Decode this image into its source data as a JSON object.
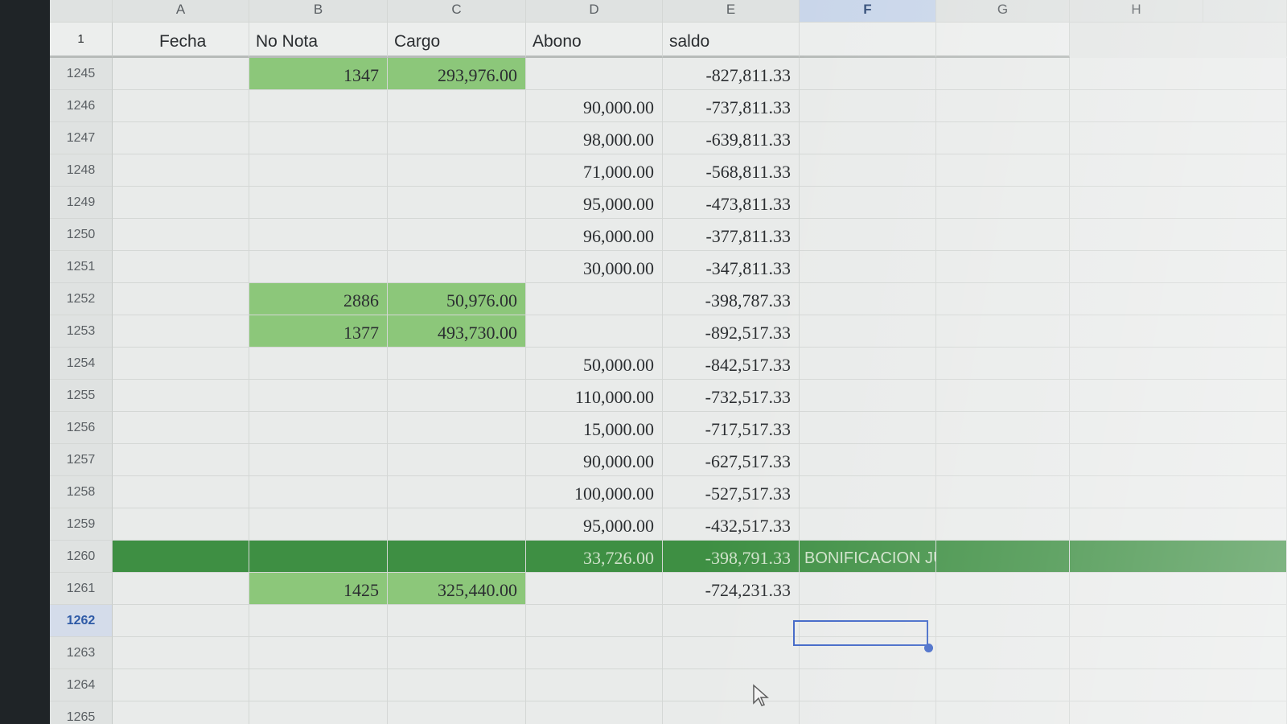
{
  "columns": [
    "A",
    "B",
    "C",
    "D",
    "E",
    "F",
    "G",
    "H"
  ],
  "selected_column": "F",
  "header_row": {
    "row_number": "1",
    "fecha": "Fecha",
    "no_nota": "No Nota",
    "cargo": "Cargo",
    "abono": "Abono",
    "saldo": "saldo"
  },
  "rows": [
    {
      "n": "1245",
      "nota": "1347",
      "cargo": "293,976.00",
      "abono": "",
      "saldo": "-827,811.33",
      "note": ""
    },
    {
      "n": "1246",
      "nota": "",
      "cargo": "",
      "abono": "90,000.00",
      "saldo": "-737,811.33",
      "note": ""
    },
    {
      "n": "1247",
      "nota": "",
      "cargo": "",
      "abono": "98,000.00",
      "saldo": "-639,811.33",
      "note": ""
    },
    {
      "n": "1248",
      "nota": "",
      "cargo": "",
      "abono": "71,000.00",
      "saldo": "-568,811.33",
      "note": ""
    },
    {
      "n": "1249",
      "nota": "",
      "cargo": "",
      "abono": "95,000.00",
      "saldo": "-473,811.33",
      "note": ""
    },
    {
      "n": "1250",
      "nota": "",
      "cargo": "",
      "abono": "96,000.00",
      "saldo": "-377,811.33",
      "note": ""
    },
    {
      "n": "1251",
      "nota": "",
      "cargo": "",
      "abono": "30,000.00",
      "saldo": "-347,811.33",
      "note": ""
    },
    {
      "n": "1252",
      "nota": "2886",
      "cargo": "50,976.00",
      "abono": "",
      "saldo": "-398,787.33",
      "note": ""
    },
    {
      "n": "1253",
      "nota": "1377",
      "cargo": "493,730.00",
      "abono": "",
      "saldo": "-892,517.33",
      "note": ""
    },
    {
      "n": "1254",
      "nota": "",
      "cargo": "",
      "abono": "50,000.00",
      "saldo": "-842,517.33",
      "note": ""
    },
    {
      "n": "1255",
      "nota": "",
      "cargo": "",
      "abono": "110,000.00",
      "saldo": "-732,517.33",
      "note": ""
    },
    {
      "n": "1256",
      "nota": "",
      "cargo": "",
      "abono": "15,000.00",
      "saldo": "-717,517.33",
      "note": ""
    },
    {
      "n": "1257",
      "nota": "",
      "cargo": "",
      "abono": "90,000.00",
      "saldo": "-627,517.33",
      "note": ""
    },
    {
      "n": "1258",
      "nota": "",
      "cargo": "",
      "abono": "100,000.00",
      "saldo": "-527,517.33",
      "note": ""
    },
    {
      "n": "1259",
      "nota": "",
      "cargo": "",
      "abono": "95,000.00",
      "saldo": "-432,517.33",
      "note": ""
    },
    {
      "n": "1260",
      "nota": "",
      "cargo": "",
      "abono": "33,726.00",
      "saldo": "-398,791.33",
      "note": "BONIFICACION JUNIO"
    },
    {
      "n": "1261",
      "nota": "1425",
      "cargo": "325,440.00",
      "abono": "",
      "saldo": "-724,231.33",
      "note": ""
    },
    {
      "n": "1262",
      "nota": "",
      "cargo": "",
      "abono": "",
      "saldo": "",
      "note": ""
    },
    {
      "n": "1263",
      "nota": "",
      "cargo": "",
      "abono": "",
      "saldo": "",
      "note": ""
    },
    {
      "n": "1264",
      "nota": "",
      "cargo": "",
      "abono": "",
      "saldo": "",
      "note": ""
    },
    {
      "n": "1265",
      "nota": "",
      "cargo": "",
      "abono": "",
      "saldo": "",
      "note": ""
    }
  ],
  "active_row": "1262",
  "colors": {
    "cargo_highlight": "#8cc77a",
    "band_highlight": "#3e8f43",
    "selection": "#3d64c6"
  },
  "icons": {
    "cursor": "mouse-pointer-icon",
    "fill_handle": "fill-handle-icon"
  }
}
